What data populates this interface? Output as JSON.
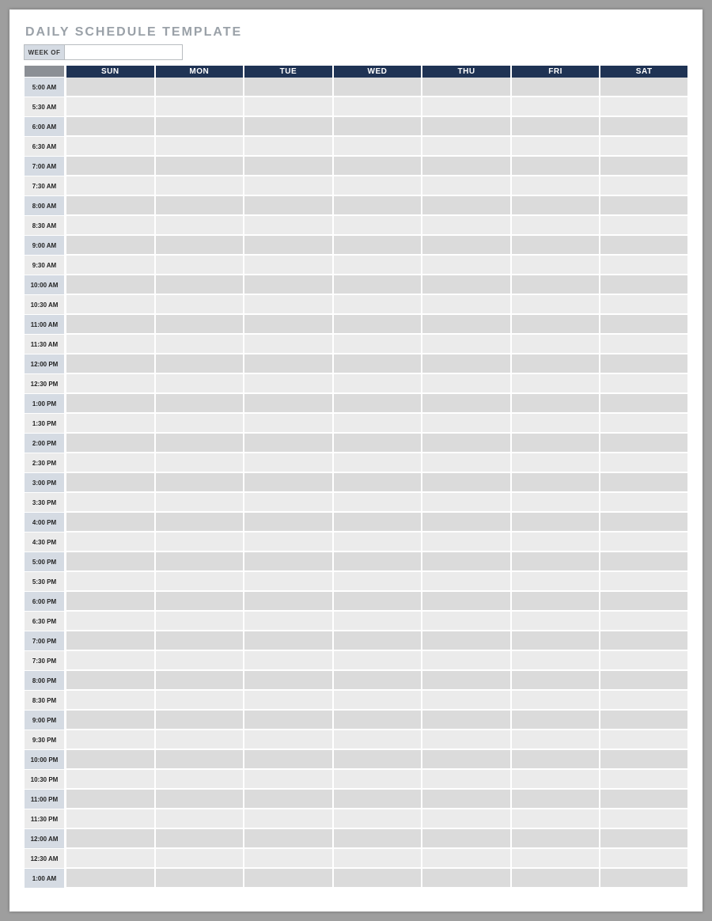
{
  "title": "DAILY SCHEDULE TEMPLATE",
  "week_of": {
    "label": "WEEK OF",
    "value": ""
  },
  "days": [
    "SUN",
    "MON",
    "TUE",
    "WED",
    "THU",
    "FRI",
    "SAT"
  ],
  "times": [
    "5:00 AM",
    "5:30 AM",
    "6:00 AM",
    "6:30 AM",
    "7:00 AM",
    "7:30 AM",
    "8:00 AM",
    "8:30 AM",
    "9:00 AM",
    "9:30 AM",
    "10:00 AM",
    "10:30 AM",
    "11:00 AM",
    "11:30 AM",
    "12:00 PM",
    "12:30 PM",
    "1:00 PM",
    "1:30 PM",
    "2:00 PM",
    "2:30 PM",
    "3:00 PM",
    "3:30 PM",
    "4:00 PM",
    "4:30 PM",
    "5:00 PM",
    "5:30 PM",
    "6:00 PM",
    "6:30 PM",
    "7:00 PM",
    "7:30 PM",
    "8:00 PM",
    "8:30 PM",
    "9:00 PM",
    "9:30 PM",
    "10:00 PM",
    "10:30 PM",
    "11:00 PM",
    "11:30 PM",
    "12:00 AM",
    "12:30 AM",
    "1:00 AM"
  ]
}
